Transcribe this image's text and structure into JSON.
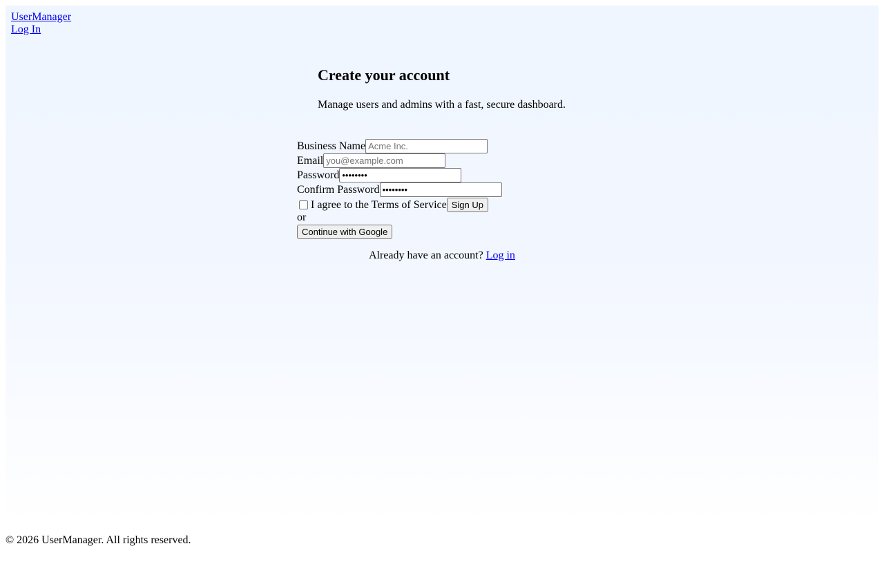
{
  "nav": {
    "brand": "UserManager",
    "login_link": "Log In"
  },
  "hero": {
    "title": "Create your account",
    "subtitle": "Manage users and admins with a fast, secure dashboard."
  },
  "form": {
    "business_name": {
      "label": "Business Name",
      "placeholder": "Acme Inc.",
      "value": ""
    },
    "email": {
      "label": "Email",
      "placeholder": "you@example.com",
      "value": ""
    },
    "password": {
      "label": "Password",
      "value": "••••••••"
    },
    "confirm_password": {
      "label": "Confirm Password",
      "value": "••••••••"
    },
    "terms": {
      "label": "I agree to the Terms of Service",
      "checked": false
    },
    "submit_label": "Sign Up",
    "separator": "or",
    "google_label": "Continue with Google"
  },
  "login_prompt": {
    "text": "Already have an account?",
    "link": "Log in"
  },
  "footer": {
    "text": "© 2026 UserManager. All rights reserved."
  },
  "colors": {
    "link": "#0000ee",
    "panel_top": "#eff6ff",
    "panel_bottom": "#ffffff",
    "button_bg": "#efefef"
  }
}
